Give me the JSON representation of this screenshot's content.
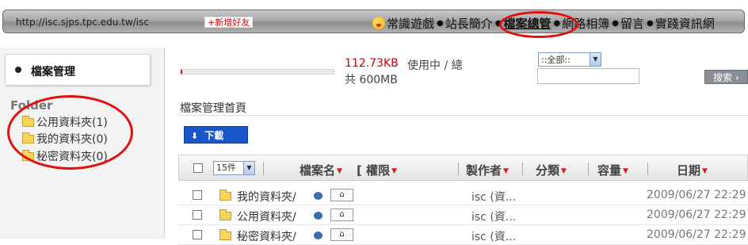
{
  "topbar": {
    "url": "http://isc.sjps.tpc.edu.tw/isc",
    "add_friend": "+新增好友",
    "nav": [
      {
        "label": "常識遊戲",
        "active": false
      },
      {
        "label": "站長簡介",
        "active": false
      },
      {
        "label": "檔案總管",
        "active": true
      },
      {
        "label": "網路相簿",
        "active": false
      },
      {
        "label": "留言",
        "active": false
      },
      {
        "label": "實踐資訊網",
        "active": false
      }
    ]
  },
  "sidebar": {
    "title": "檔案管理",
    "folder_heading": "Folder",
    "folders": [
      {
        "label": "公用資料夾(1)"
      },
      {
        "label": "我的資料夾(0)"
      },
      {
        "label": "秘密資料夾(0)"
      }
    ]
  },
  "main": {
    "quota": {
      "used": "112.73KB",
      "used_label": "使用中 / 總",
      "total": "共 600MB",
      "fraction": 0.0002
    },
    "scope_select": "::全部::",
    "search_value": "",
    "search_button": "搜索",
    "breadcrumb": "檔案管理首頁",
    "download_button": "下載",
    "page_size": "15件",
    "columns": {
      "name": "檔案名",
      "permission": "[ 權限",
      "owner": "製作者",
      "category": "分類",
      "size": "容量",
      "date": "日期"
    },
    "rows": [
      {
        "name": "我的資料夾/",
        "owner": "isc (資...",
        "date": "2009/06/27 22:29"
      },
      {
        "name": "公用資料夾/",
        "owner": "isc (資...",
        "date": "2009/06/27 22:29"
      },
      {
        "name": "秘密資料夾/",
        "owner": "isc (資...",
        "date": "2009/06/27 22:29"
      }
    ]
  },
  "colors": {
    "accent_red": "#cc2222",
    "download_blue": "#1a56c8",
    "annotation_circle": "#e01010"
  }
}
